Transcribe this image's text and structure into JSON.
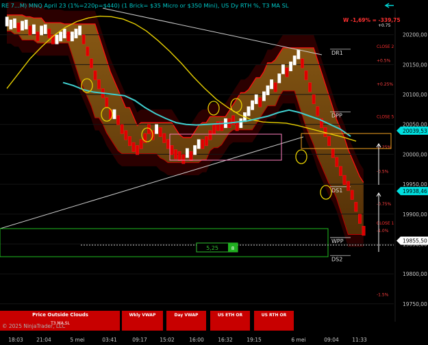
{
  "header": {
    "title": "RE 7...M) MNQ April 23 (1%=220p=$440) (1 Brick= $35 Micro or $350 Mini), US Dy RTH %, T3 MA SL"
  },
  "pnl": {
    "text": "W -1,69% = -339,75",
    "sub": "+0.75"
  },
  "copyright": "© 2025 NinjaTrader, LLC",
  "toolbar": {
    "buttons": [
      {
        "label": "Price Outside Clouds",
        "sub": "T3 MA SL"
      },
      {
        "label": "Wkly VWAP"
      },
      {
        "label": "Day VWAP"
      },
      {
        "label": "US ETH OR"
      },
      {
        "label": "US RTH OR"
      }
    ]
  },
  "range_box": {
    "label": "5,25",
    "badge": "8"
  },
  "colors": {
    "background": "#000000",
    "up": "#ffffff",
    "down": "#e00000",
    "cloud": "#8a5a10",
    "cloud_dark": "#3a0000",
    "cyan": "#40d0d0",
    "yellow": "#e8d000",
    "orange": "#f0a020",
    "accent": "#00e0e0"
  },
  "chart_data": {
    "type": "line",
    "series_type": "renko",
    "title": "",
    "x_ticks": [
      "18:03",
      "21:04",
      "5 mei",
      "03:41",
      "09:17",
      "15:02",
      "16:00",
      "16:32",
      "19:15",
      "6 mei",
      "09:04",
      "11:33"
    ],
    "y_ticks": [
      20200,
      20150,
      20100,
      20050,
      20000,
      19950,
      19900,
      19850,
      19800,
      19750
    ],
    "y_tick_labels": [
      "20200,00",
      "20150,00",
      "20100,00",
      "20050,00",
      "20000,00",
      "19950,00",
      "19900,00",
      "19850,00",
      "19800,00",
      "19750,00"
    ],
    "ylim": [
      19720,
      20242
    ],
    "price_markers": [
      {
        "value": 20039.53,
        "label": "20039,53"
      },
      {
        "value": 19938.46,
        "label": "19938,46"
      },
      {
        "value": 19855.5,
        "label": "19855,50"
      }
    ],
    "levels": [
      {
        "name": "DR1",
        "value": 20170
      },
      {
        "name": "DPP",
        "value": 20065
      },
      {
        "name": "DS1",
        "value": 19940
      },
      {
        "name": "WPP",
        "value": 19855
      },
      {
        "name": "DS2",
        "value": 19825
      }
    ],
    "pct_labels": [
      {
        "label": "CLOSE 2",
        "value": 20180
      },
      {
        "label": "+0.5%",
        "value": 20157
      },
      {
        "label": "+0.25%",
        "value": 20117
      },
      {
        "label": "CLOSE 5",
        "value": 20063
      },
      {
        "label": "-0.25%",
        "value": 20012
      },
      {
        "label": "-0.5%",
        "value": 19971
      },
      {
        "label": "-0.75%",
        "value": 19917
      },
      {
        "label": "CLOSE 1",
        "value": 19885
      },
      {
        "label": "-1.0%",
        "value": 19872
      },
      {
        "label": "-1.5%",
        "value": 19765
      }
    ],
    "bricks": [
      {
        "x": 0,
        "dir": "up"
      },
      {
        "x": 1,
        "dir": "up"
      },
      {
        "x": 2,
        "dir": "up"
      },
      {
        "x": 3,
        "dir": "down"
      },
      {
        "x": 4,
        "dir": "up"
      },
      {
        "x": 5,
        "dir": "up"
      },
      {
        "x": 6,
        "dir": "down"
      },
      {
        "x": 7,
        "dir": "up"
      },
      {
        "x": 8,
        "dir": "down"
      },
      {
        "x": 9,
        "dir": "up"
      },
      {
        "x": 10,
        "dir": "up"
      },
      {
        "x": 11,
        "dir": "down"
      },
      {
        "x": 12,
        "dir": "down"
      },
      {
        "x": 13,
        "dir": "up"
      },
      {
        "x": 14,
        "dir": "up"
      },
      {
        "x": 15,
        "dir": "up"
      },
      {
        "x": 16,
        "dir": "down"
      },
      {
        "x": 17,
        "dir": "up"
      },
      {
        "x": 18,
        "dir": "up"
      },
      {
        "x": 19,
        "dir": "up"
      },
      {
        "x": 20,
        "dir": "down"
      },
      {
        "x": 21,
        "dir": "down"
      },
      {
        "x": 22,
        "dir": "down"
      },
      {
        "x": 23,
        "dir": "down"
      },
      {
        "x": 24,
        "dir": "down"
      },
      {
        "x": 25,
        "dir": "down"
      },
      {
        "x": 26,
        "dir": "down"
      },
      {
        "x": 27,
        "dir": "down"
      },
      {
        "x": 28,
        "dir": "up"
      },
      {
        "x": 29,
        "dir": "down"
      },
      {
        "x": 30,
        "dir": "down"
      },
      {
        "x": 31,
        "dir": "down"
      },
      {
        "x": 32,
        "dir": "down"
      },
      {
        "x": 33,
        "dir": "down"
      },
      {
        "x": 34,
        "dir": "down"
      },
      {
        "x": 35,
        "dir": "down"
      },
      {
        "x": 36,
        "dir": "down"
      },
      {
        "x": 37,
        "dir": "down"
      },
      {
        "x": 38,
        "dir": "down"
      },
      {
        "x": 39,
        "dir": "up"
      },
      {
        "x": 40,
        "dir": "down"
      },
      {
        "x": 41,
        "dir": "down"
      },
      {
        "x": 42,
        "dir": "down"
      },
      {
        "x": 43,
        "dir": "down"
      },
      {
        "x": 44,
        "dir": "down"
      },
      {
        "x": 45,
        "dir": "down"
      },
      {
        "x": 46,
        "dir": "down"
      },
      {
        "x": 47,
        "dir": "up"
      },
      {
        "x": 48,
        "dir": "down"
      },
      {
        "x": 49,
        "dir": "up"
      },
      {
        "x": 50,
        "dir": "up"
      },
      {
        "x": 51,
        "dir": "down"
      },
      {
        "x": 52,
        "dir": "down"
      },
      {
        "x": 53,
        "dir": "down"
      },
      {
        "x": 54,
        "dir": "down"
      },
      {
        "x": 55,
        "dir": "down"
      },
      {
        "x": 56,
        "dir": "down"
      },
      {
        "x": 57,
        "dir": "up"
      },
      {
        "x": 58,
        "dir": "down"
      },
      {
        "x": 59,
        "dir": "down"
      },
      {
        "x": 60,
        "dir": "down"
      },
      {
        "x": 61,
        "dir": "up"
      },
      {
        "x": 62,
        "dir": "up"
      },
      {
        "x": 63,
        "dir": "up"
      },
      {
        "x": 64,
        "dir": "up"
      },
      {
        "x": 65,
        "dir": "up"
      },
      {
        "x": 66,
        "dir": "down"
      },
      {
        "x": 67,
        "dir": "up"
      },
      {
        "x": 68,
        "dir": "up"
      },
      {
        "x": 69,
        "dir": "up"
      },
      {
        "x": 70,
        "dir": "down"
      },
      {
        "x": 71,
        "dir": "up"
      },
      {
        "x": 72,
        "dir": "up"
      },
      {
        "x": 73,
        "dir": "down"
      },
      {
        "x": 74,
        "dir": "up"
      },
      {
        "x": 75,
        "dir": "up"
      },
      {
        "x": 76,
        "dir": "up"
      },
      {
        "x": 77,
        "dir": "down"
      },
      {
        "x": 78,
        "dir": "down"
      },
      {
        "x": 79,
        "dir": "down"
      },
      {
        "x": 80,
        "dir": "down"
      },
      {
        "x": 81,
        "dir": "down"
      },
      {
        "x": 82,
        "dir": "down"
      },
      {
        "x": 83,
        "dir": "down"
      },
      {
        "x": 84,
        "dir": "down"
      },
      {
        "x": 85,
        "dir": "down"
      },
      {
        "x": 86,
        "dir": "down"
      },
      {
        "x": 87,
        "dir": "down"
      },
      {
        "x": 88,
        "dir": "down"
      },
      {
        "x": 89,
        "dir": "down"
      },
      {
        "x": 90,
        "dir": "down"
      },
      {
        "x": 91,
        "dir": "down"
      },
      {
        "x": 92,
        "dir": "down"
      },
      {
        "x": 93,
        "dir": "down"
      }
    ],
    "close": [
      20225,
      20220,
      20222,
      20210,
      20218,
      20220,
      20205,
      20212,
      20195,
      20210,
      20212,
      20200,
      20190,
      20195,
      20200,
      20205,
      20195,
      20200,
      20205,
      20210,
      20190,
      20170,
      20150,
      20130,
      20115,
      20100,
      20085,
      20065,
      20070,
      20055,
      20040,
      20030,
      20020,
      20010,
      20005,
      20015,
      20025,
      20040,
      20030,
      20045,
      20035,
      20025,
      20015,
      20005,
      19998,
      19995,
      19990,
      20005,
      19995,
      20010,
      20020,
      20015,
      20020,
      20030,
      20040,
      20045,
      20045,
      20055,
      20050,
      20055,
      20045,
      20055,
      20065,
      20075,
      20085,
      20095,
      20085,
      20100,
      20110,
      20120,
      20110,
      20130,
      20145,
      20135,
      20150,
      20160,
      20170,
      20150,
      20130,
      20110,
      20090,
      20070,
      20050,
      20035,
      20020,
      20000,
      19985,
      19970,
      19955,
      19945,
      19930,
      19910,
      19890,
      19870
    ],
    "t3_ma": [
      20110,
      20135,
      20160,
      20180,
      20198,
      20212,
      20222,
      20228,
      20231,
      20230,
      20226,
      20218,
      20206,
      20190,
      20172,
      20152,
      20130,
      20110,
      20092,
      20078,
      20066,
      20058,
      20054,
      20053,
      20052,
      20048,
      20043,
      20038,
      20033,
      20028,
      20022
    ],
    "cyan_ma": [
      20120,
      20115,
      20108,
      20104,
      20102,
      20100,
      20098,
      20090,
      20078,
      20068,
      20060,
      20053,
      20050,
      20049,
      20050,
      20051,
      20052,
      20054,
      20056,
      20060,
      20064,
      20070,
      20074,
      20070,
      20064,
      20058,
      20050,
      20042,
      20030
    ]
  }
}
